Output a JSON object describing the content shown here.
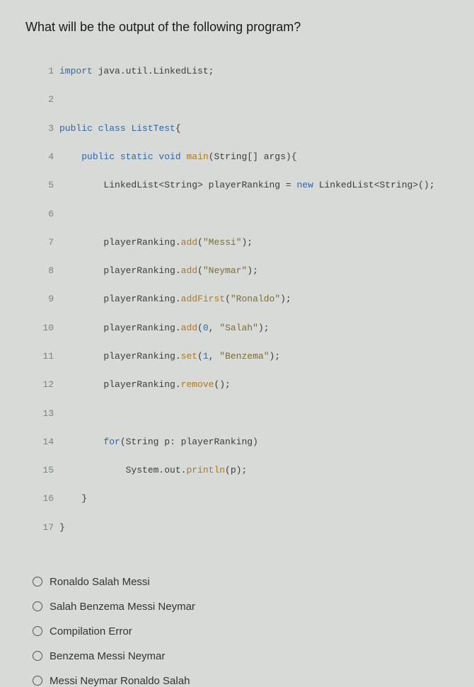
{
  "question": "What will be the output of the following program?",
  "code": {
    "lines": [
      "import java.util.LinkedList;",
      "",
      "public class ListTest{",
      "    public static void main(String[] args){",
      "        LinkedList<String> playerRanking = new LinkedList<String>();",
      "",
      "        playerRanking.add(\"Messi\");",
      "        playerRanking.add(\"Neymar\");",
      "        playerRanking.addFirst(\"Ronaldo\");",
      "        playerRanking.add(0, \"Salah\");",
      "        playerRanking.set(1, \"Benzema\");",
      "        playerRanking.remove();",
      "",
      "        for(String p: playerRanking)",
      "            System.out.println(p);",
      "    }",
      "}"
    ]
  },
  "options": [
    {
      "label": "Ronaldo Salah Messi"
    },
    {
      "label": "Salah Benzema Messi Neymar"
    },
    {
      "label": "Compilation Error"
    },
    {
      "label": "Benzema Messi Neymar"
    },
    {
      "label": "Messi Neymar Ronaldo Salah"
    }
  ]
}
